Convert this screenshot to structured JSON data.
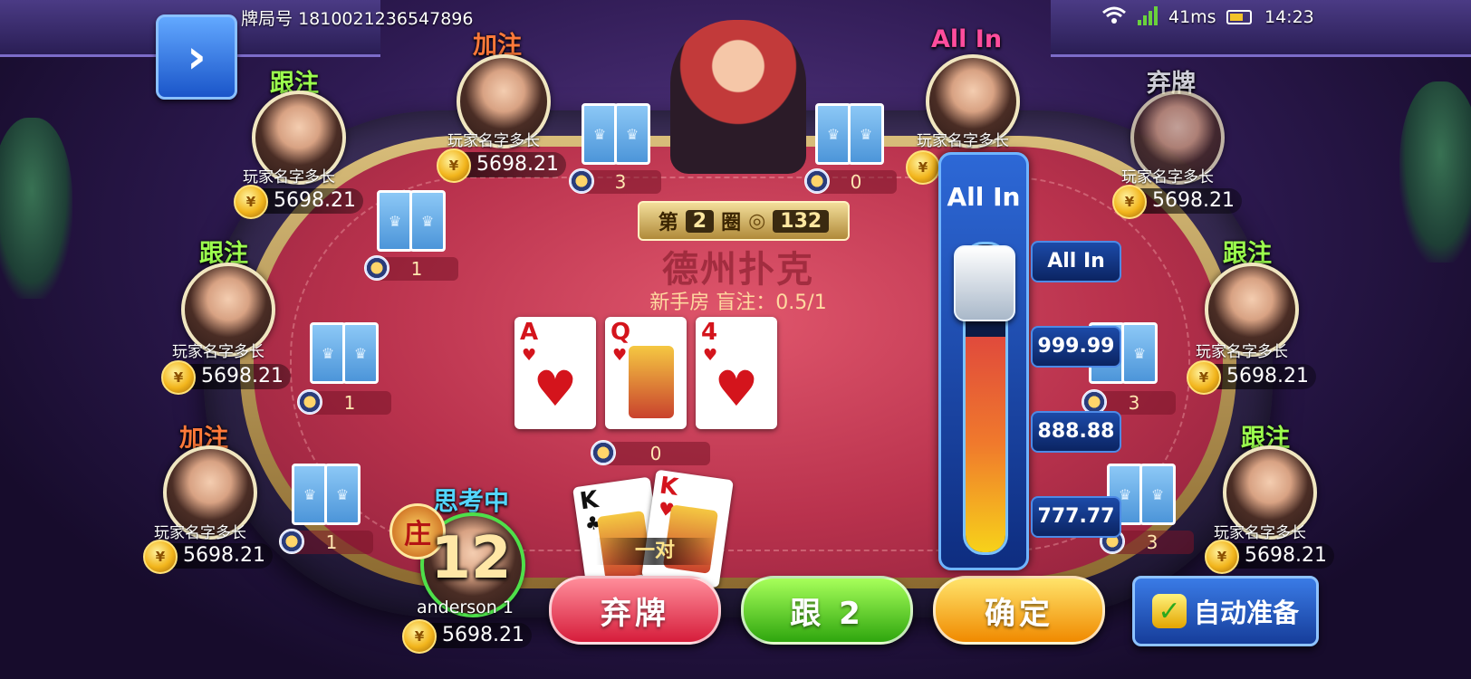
{
  "status_bar": {
    "hand_id_label": "牌局号",
    "hand_id": "1810021236547896",
    "latency": "41ms",
    "time": "14:23",
    "signal_color": "#6ad23c"
  },
  "dealer_area": {
    "left_bet": "3",
    "right_bet": "0"
  },
  "round_info": {
    "prefix": "第",
    "round": "2",
    "suffix": "圈",
    "pot": "132"
  },
  "table": {
    "game_title": "德州扑克",
    "room_info": "新手房 盲注：0.5/1"
  },
  "community_cards": [
    {
      "rank": "A",
      "suit": "♥"
    },
    {
      "rank": "Q",
      "suit": "♥"
    },
    {
      "rank": "4",
      "suit": "♥"
    }
  ],
  "main_pot": "0",
  "players": [
    {
      "seat": "top-left",
      "action": "加注",
      "name": "玩家名字多长",
      "chips": "5698.21"
    },
    {
      "seat": "upper-left",
      "action": "跟注",
      "name": "玩家名字多长",
      "chips": "5698.21",
      "bet": "1"
    },
    {
      "seat": "mid-left",
      "action": "跟注",
      "name": "玩家名字多长",
      "chips": "5698.21",
      "bet": "1"
    },
    {
      "seat": "lower-left",
      "action": "加注",
      "name": "玩家名字多长",
      "chips": "5698.21",
      "bet": "1"
    },
    {
      "seat": "top-right",
      "action": "All In",
      "name": "玩家名字多长",
      "chips": ""
    },
    {
      "seat": "upper-right",
      "action": "弃牌",
      "name": "玩家名字多长",
      "chips": "5698.21"
    },
    {
      "seat": "mid-right",
      "action": "跟注",
      "name": "玩家名字多长",
      "chips": "5698.21",
      "bet": "3"
    },
    {
      "seat": "lower-right",
      "action": "跟注",
      "name": "玩家名字多长",
      "chips": "5698.21",
      "bet": "3"
    }
  ],
  "me": {
    "status": "思考中",
    "banker_badge": "庄",
    "timer": "12",
    "name": "anderson 1",
    "chips": "5698.21",
    "cards": [
      {
        "rank": "K",
        "suit": "♣",
        "color": "#111111"
      },
      {
        "rank": "K",
        "suit": "♥",
        "color": "#d4141c"
      }
    ],
    "hand_label": "一对"
  },
  "raise_slider": {
    "label": "All In",
    "presets": [
      "All In",
      "999.99",
      "888.88",
      "777.77"
    ],
    "level_percent": 70
  },
  "buttons": {
    "fold": "弃牌",
    "call": "跟 2",
    "confirm": "确定",
    "auto_ready": "自动准备"
  }
}
